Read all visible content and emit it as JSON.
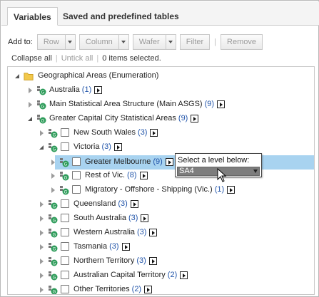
{
  "tabs": [
    {
      "label": "Variables"
    },
    {
      "label": "Saved and predefined tables"
    }
  ],
  "toolbar": {
    "add_to_label": "Add to:",
    "row_label": "Row",
    "column_label": "Column",
    "wafer_label": "Wafer",
    "filter_label": "Filter",
    "remove_label": "Remove",
    "separator": "|"
  },
  "links": {
    "collapse_all": "Collapse all",
    "untick_all": "Untick all",
    "selected_count": "0 items selected."
  },
  "tree": {
    "root": {
      "label": "Geographical Areas (Enumeration)"
    },
    "items": [
      {
        "label": "Australia",
        "count": "(1)"
      },
      {
        "label": "Main Statistical Area Structure (Main ASGS)",
        "count": "(9)"
      },
      {
        "label": "Greater Capital City Statistical Areas",
        "count": "(9)"
      },
      {
        "label": "New South Wales",
        "count": "(3)"
      },
      {
        "label": "Victoria",
        "count": "(3)"
      },
      {
        "label": "Greater Melbourne",
        "count": "(9)"
      },
      {
        "label": "Rest of Vic.",
        "count": "(8)"
      },
      {
        "label": "Migratory - Offshore - Shipping (Vic.)",
        "count": "(1)"
      },
      {
        "label": "Queensland",
        "count": "(3)"
      },
      {
        "label": "South Australia",
        "count": "(3)"
      },
      {
        "label": "Western Australia",
        "count": "(3)"
      },
      {
        "label": "Tasmania",
        "count": "(3)"
      },
      {
        "label": "Northern Territory",
        "count": "(3)"
      },
      {
        "label": "Australian Capital Territory",
        "count": "(2)"
      },
      {
        "label": "Other Territories",
        "count": "(2)"
      }
    ]
  },
  "popup": {
    "title": "Select a level below:",
    "selected": "SA4"
  },
  "colors": {
    "selection_highlight": "#a8d3f0",
    "folder": "#f2c84b",
    "node_icon_green": "#2e9c5a",
    "count_blue": "#2255aa"
  },
  "icons": {
    "folder": "folder-icon",
    "node": "hierarchy-node-icon",
    "nav": "expand-levels-icon",
    "cursor": "mouse-pointer-icon"
  }
}
